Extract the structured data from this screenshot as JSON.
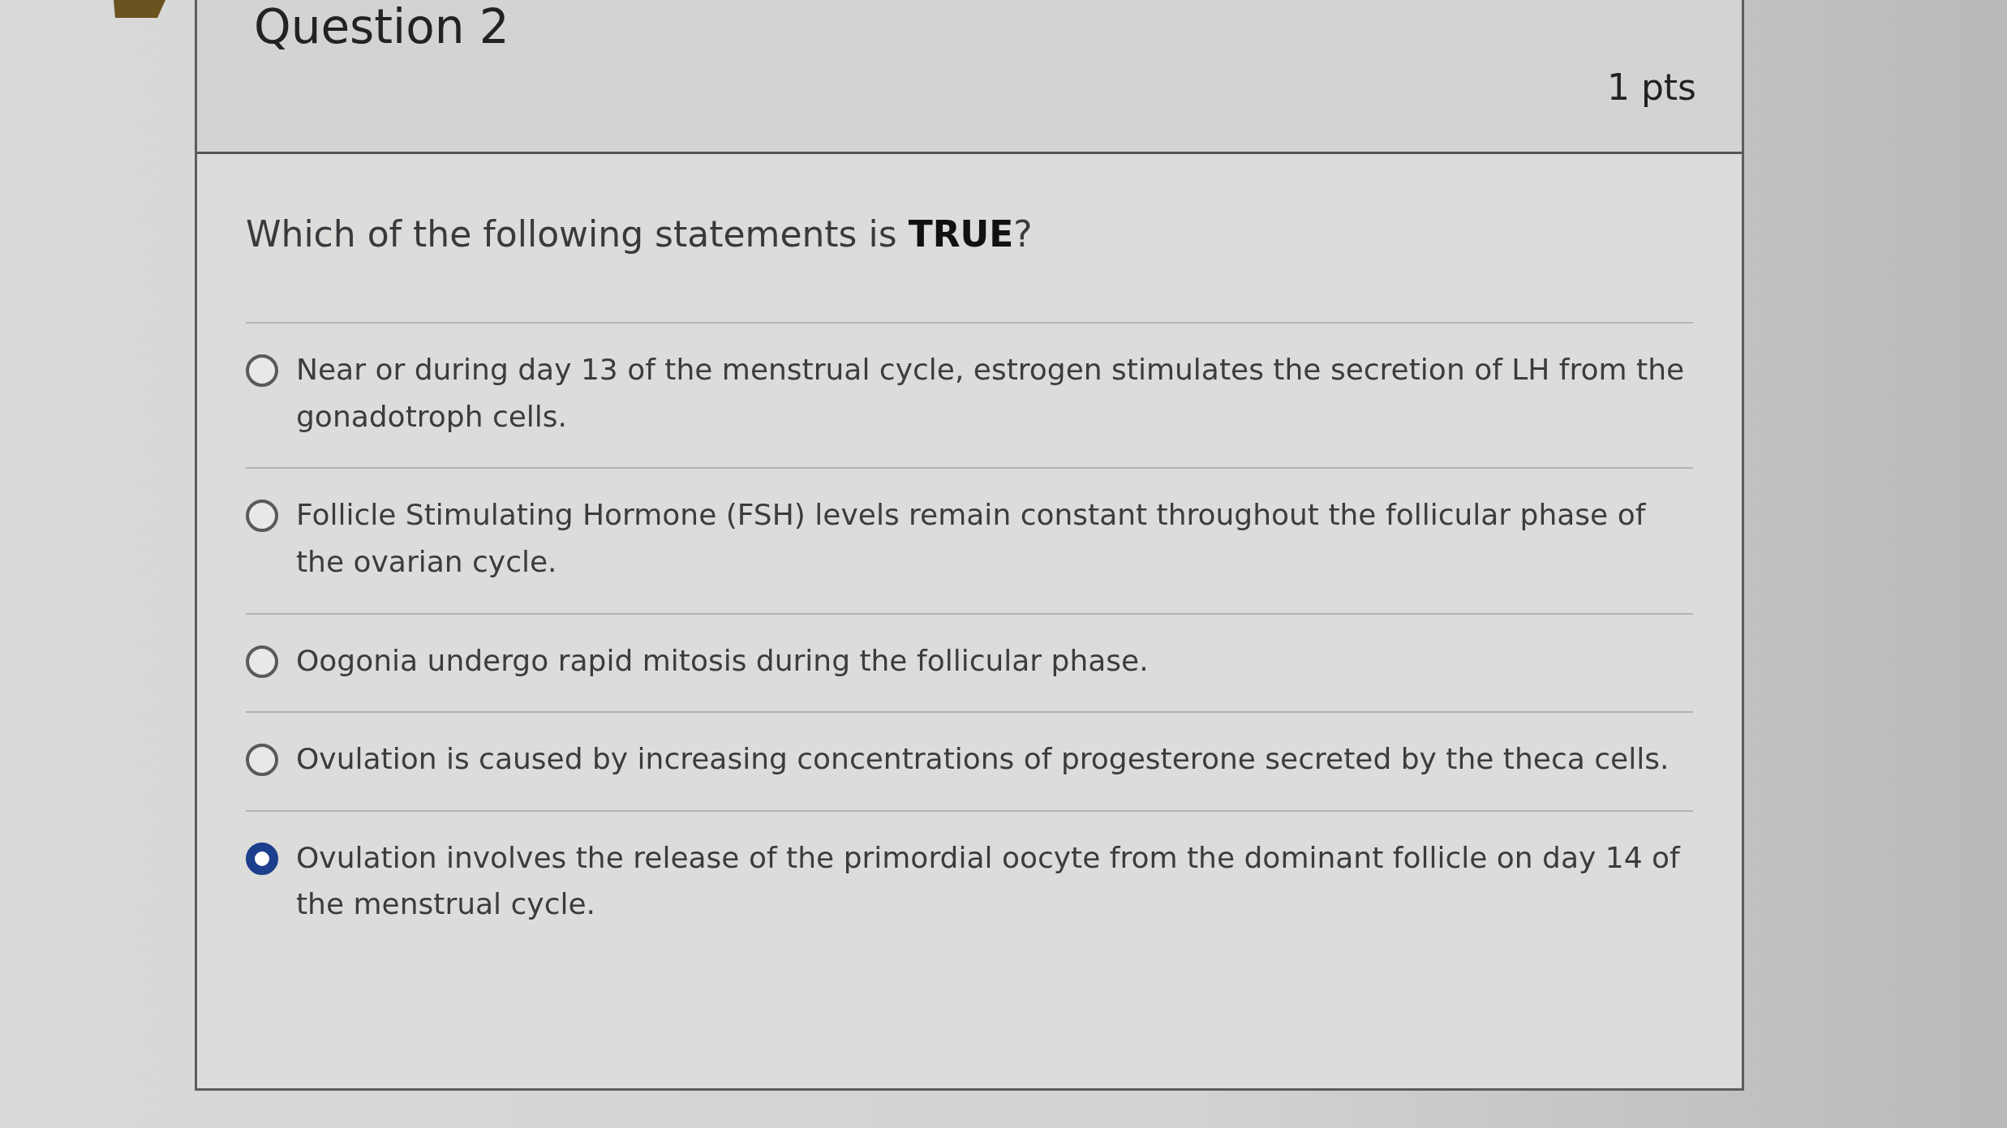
{
  "question": {
    "title": "Question 2",
    "points": "1 pts",
    "prompt": "Which of the following statements is **TRUE**?"
  },
  "answers": [
    {
      "text": "Near or during day 13 of the menstrual cycle, estrogen stimulates the secretion of LH from the gonadotroph cells.",
      "selected": false
    },
    {
      "text": "Follicle Stimulating Hormone (FSH) levels remain constant throughout the follicular phase of the ovarian cycle.",
      "selected": false
    },
    {
      "text": "Oogonia undergo rapid mitosis during the follicular phase.",
      "selected": false
    },
    {
      "text": "Ovulation is caused by increasing concentrations of progesterone secreted by the theca cells.",
      "selected": false
    },
    {
      "text": "Ovulation involves the release of the primordial oocyte from the dominant follicle on day 14 of the menstrual cycle.",
      "selected": true
    }
  ]
}
